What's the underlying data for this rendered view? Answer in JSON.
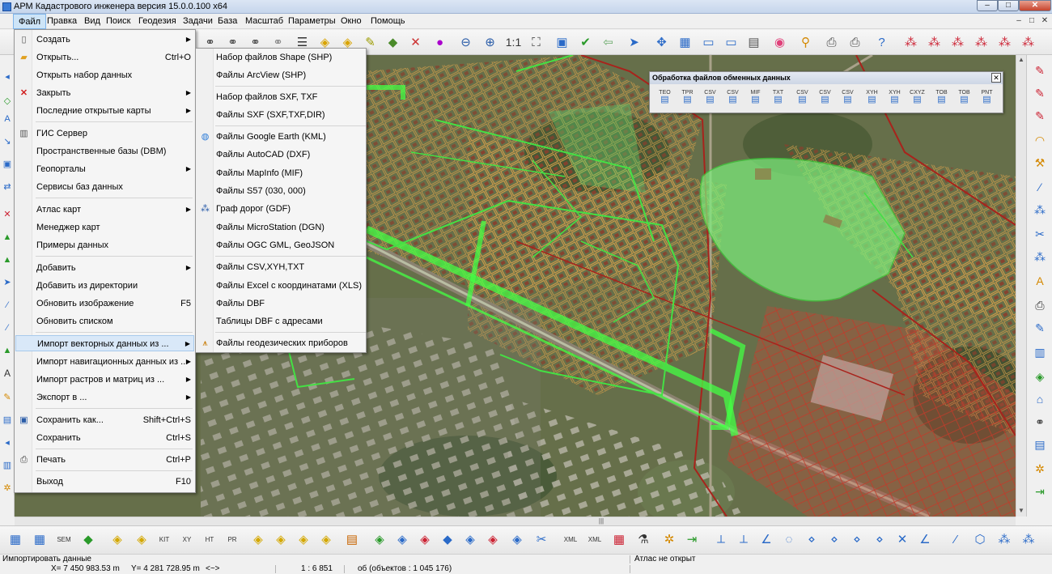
{
  "window": {
    "title": "АРМ Кадастрового инженера версия 15.0.0.100 x64",
    "buttons": {
      "minimize": "–",
      "maximize": "□",
      "close": "✕"
    }
  },
  "menubar": {
    "items": [
      "Файл",
      "Правка",
      "Вид",
      "Поиск",
      "Геодезия",
      "Задачи",
      "База",
      "Масштаб",
      "Параметры",
      "Окно",
      "Помощь"
    ],
    "active_index": 0,
    "mdi_buttons": {
      "minimize": "–",
      "restore": "□",
      "close": "✕"
    }
  },
  "toolbar": {
    "zoom_one_label": "1:1"
  },
  "file_menu": {
    "items": [
      {
        "label": "Создать",
        "shortcut": "",
        "submenu": true,
        "icon": "new-file-icon"
      },
      {
        "label": "Открыть...",
        "shortcut": "Ctrl+O",
        "submenu": false,
        "icon": "open-folder-icon"
      },
      {
        "label": "Открыть набор данных",
        "shortcut": "",
        "submenu": false,
        "icon": ""
      },
      {
        "label": "Закрыть",
        "shortcut": "",
        "submenu": true,
        "icon": "close-red-icon"
      },
      {
        "label": "Последние открытые карты",
        "shortcut": "",
        "submenu": true,
        "icon": ""
      },
      {
        "label": "ГИС Сервер",
        "shortcut": "",
        "submenu": false,
        "icon": "gis-server-icon"
      },
      {
        "label": "Пространственные базы (DBM)",
        "shortcut": "",
        "submenu": false,
        "icon": ""
      },
      {
        "label": "Геопорталы",
        "shortcut": "",
        "submenu": true,
        "icon": ""
      },
      {
        "label": "Сервисы баз данных",
        "shortcut": "",
        "submenu": false,
        "icon": ""
      },
      {
        "label": "Атлас карт",
        "shortcut": "",
        "submenu": true,
        "icon": ""
      },
      {
        "label": "Менеджер карт",
        "shortcut": "",
        "submenu": false,
        "icon": ""
      },
      {
        "label": "Примеры данных",
        "shortcut": "",
        "submenu": false,
        "icon": ""
      },
      {
        "label": "Добавить",
        "shortcut": "",
        "submenu": true,
        "icon": ""
      },
      {
        "label": "Добавить из директории",
        "shortcut": "",
        "submenu": false,
        "icon": ""
      },
      {
        "label": "Обновить изображение",
        "shortcut": "F5",
        "submenu": false,
        "icon": ""
      },
      {
        "label": "Обновить списком",
        "shortcut": "",
        "submenu": false,
        "icon": ""
      },
      {
        "label": "Импорт векторных данных из ...",
        "shortcut": "",
        "submenu": true,
        "icon": ""
      },
      {
        "label": "Импорт навигационных данных из ...",
        "shortcut": "",
        "submenu": true,
        "icon": ""
      },
      {
        "label": "Импорт растров и матриц из ...",
        "shortcut": "",
        "submenu": true,
        "icon": ""
      },
      {
        "label": "Экспорт в ...",
        "shortcut": "",
        "submenu": true,
        "icon": ""
      },
      {
        "label": "Сохранить как...",
        "shortcut": "Shift+Ctrl+S",
        "submenu": false,
        "icon": "save-as-icon"
      },
      {
        "label": "Сохранить",
        "shortcut": "Ctrl+S",
        "submenu": false,
        "icon": ""
      },
      {
        "label": "Печать",
        "shortcut": "Ctrl+P",
        "submenu": false,
        "icon": "printer-icon"
      },
      {
        "label": "Выход",
        "shortcut": "F10",
        "submenu": false,
        "icon": ""
      }
    ],
    "highlighted_index": 16
  },
  "import_submenu": {
    "items": [
      {
        "label": "Набор файлов Shape (SHP)",
        "icon": ""
      },
      {
        "label": "Файлы ArcView (SHP)",
        "icon": ""
      },
      {
        "label": "Набор файлов SXF, TXF",
        "icon": ""
      },
      {
        "label": "Файлы SXF (SXF,TXF,DIR)",
        "icon": ""
      },
      {
        "label": "Файлы Google Earth (KML)",
        "icon": "globe-icon"
      },
      {
        "label": "Файлы AutoCAD (DXF)",
        "icon": ""
      },
      {
        "label": "Файлы MapInfo (MIF)",
        "icon": ""
      },
      {
        "label": "Файлы S57 (030, 000)",
        "icon": ""
      },
      {
        "label": "Граф дорог (GDF)",
        "icon": "road-graph-icon"
      },
      {
        "label": "Файлы MicroStation (DGN)",
        "icon": ""
      },
      {
        "label": "Файлы OGC GML, GeoJSON",
        "icon": ""
      },
      {
        "label": "Файлы CSV,XYH,TXT",
        "icon": ""
      },
      {
        "label": "Файлы Excel с координатами (XLS)",
        "icon": ""
      },
      {
        "label": "Файлы DBF",
        "icon": ""
      },
      {
        "label": "Таблицы DBF с адресами",
        "icon": ""
      },
      {
        "label": "Файлы геодезических приборов",
        "icon": "survey-instrument-icon"
      }
    ]
  },
  "exchange_panel": {
    "title": "Обработка файлов обменных данных",
    "close": "✕",
    "buttons": [
      "TEO",
      "TPR",
      "CSV",
      "CSV",
      "MIF",
      "TXT",
      "CSV",
      "CSV",
      "CSV",
      "XYH",
      "XYH",
      "CXYZ",
      "TOB",
      "TOB",
      "PNT"
    ]
  },
  "bottom_toolbar": {
    "labels": [
      "",
      "",
      "SEM",
      "",
      "",
      "",
      "KIT",
      "XY",
      "HT",
      "PR",
      "",
      "",
      "",
      "",
      "",
      "",
      "",
      "",
      "",
      "",
      "XML",
      "XML"
    ]
  },
  "status": {
    "action": "Импортировать данные",
    "atlas": "Атлас не открыт",
    "x_coord": "X= 7 450 983.53 m",
    "y_coord": "Y= 4 281 728.95 m",
    "arrows": "<~>",
    "scale": "1 : 6 851",
    "objects": "об (объектов : 1 045 176)"
  }
}
